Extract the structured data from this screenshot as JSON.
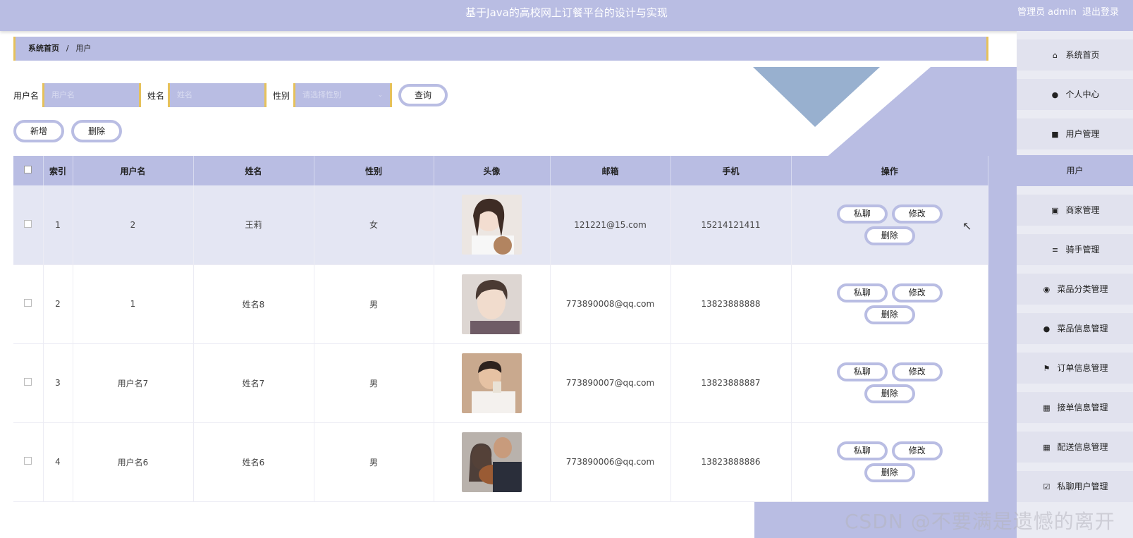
{
  "header": {
    "title": "基于Java的高校网上订餐平台的设计与实现",
    "user_role": "管理员",
    "user_name": "admin",
    "logout": "退出登录"
  },
  "breadcrumb": {
    "home": "系统首页",
    "separator": "/",
    "current": "用户"
  },
  "search": {
    "username_label": "用户名",
    "username_placeholder": "用户名",
    "name_label": "姓名",
    "name_placeholder": "姓名",
    "gender_label": "性别",
    "gender_placeholder": "请选择性别",
    "query_button": "查询"
  },
  "actions": {
    "add": "新增",
    "delete": "删除"
  },
  "table": {
    "headers": [
      "索引",
      "用户名",
      "姓名",
      "性别",
      "头像",
      "邮箱",
      "手机",
      "操作"
    ],
    "row_buttons": {
      "chat": "私聊",
      "edit": "修改",
      "delete": "删除"
    },
    "rows": [
      {
        "index": "1",
        "username": "2",
        "name": "王莉",
        "gender": "女",
        "email": "121221@15.com",
        "phone": "15214121411",
        "avatar_color": "#e8d8cc"
      },
      {
        "index": "2",
        "username": "1",
        "name": "姓名8",
        "gender": "男",
        "email": "773890008@qq.com",
        "phone": "13823888888",
        "avatar_color": "#d7c6b8"
      },
      {
        "index": "3",
        "username": "用户名7",
        "name": "姓名7",
        "gender": "男",
        "email": "773890007@qq.com",
        "phone": "13823888887",
        "avatar_color": "#c7a583"
      },
      {
        "index": "4",
        "username": "用户名6",
        "name": "姓名6",
        "gender": "男",
        "email": "773890006@qq.com",
        "phone": "13823888886",
        "avatar_color": "#6b4a3a"
      }
    ]
  },
  "sidebar": {
    "items": [
      {
        "label": "系统首页",
        "icon": "home-icon"
      },
      {
        "label": "个人中心",
        "icon": "person-icon"
      },
      {
        "label": "用户管理",
        "icon": "chat-icon"
      },
      {
        "label": "商家管理",
        "icon": "briefcase-icon"
      },
      {
        "label": "骑手管理",
        "icon": "list-icon"
      },
      {
        "label": "菜品分类管理",
        "icon": "bulb-icon"
      },
      {
        "label": "菜品信息管理",
        "icon": "person-icon"
      },
      {
        "label": "订单信息管理",
        "icon": "flag-icon"
      },
      {
        "label": "接单信息管理",
        "icon": "grid-icon"
      },
      {
        "label": "配送信息管理",
        "icon": "grid-icon"
      },
      {
        "label": "私聊用户管理",
        "icon": "clipboard-icon"
      }
    ],
    "sub_item": "用户"
  },
  "watermark": "CSDN @不要满是遗憾的离开",
  "colors": {
    "accent": "#b9bde3",
    "border_accent": "#e6c15a"
  }
}
